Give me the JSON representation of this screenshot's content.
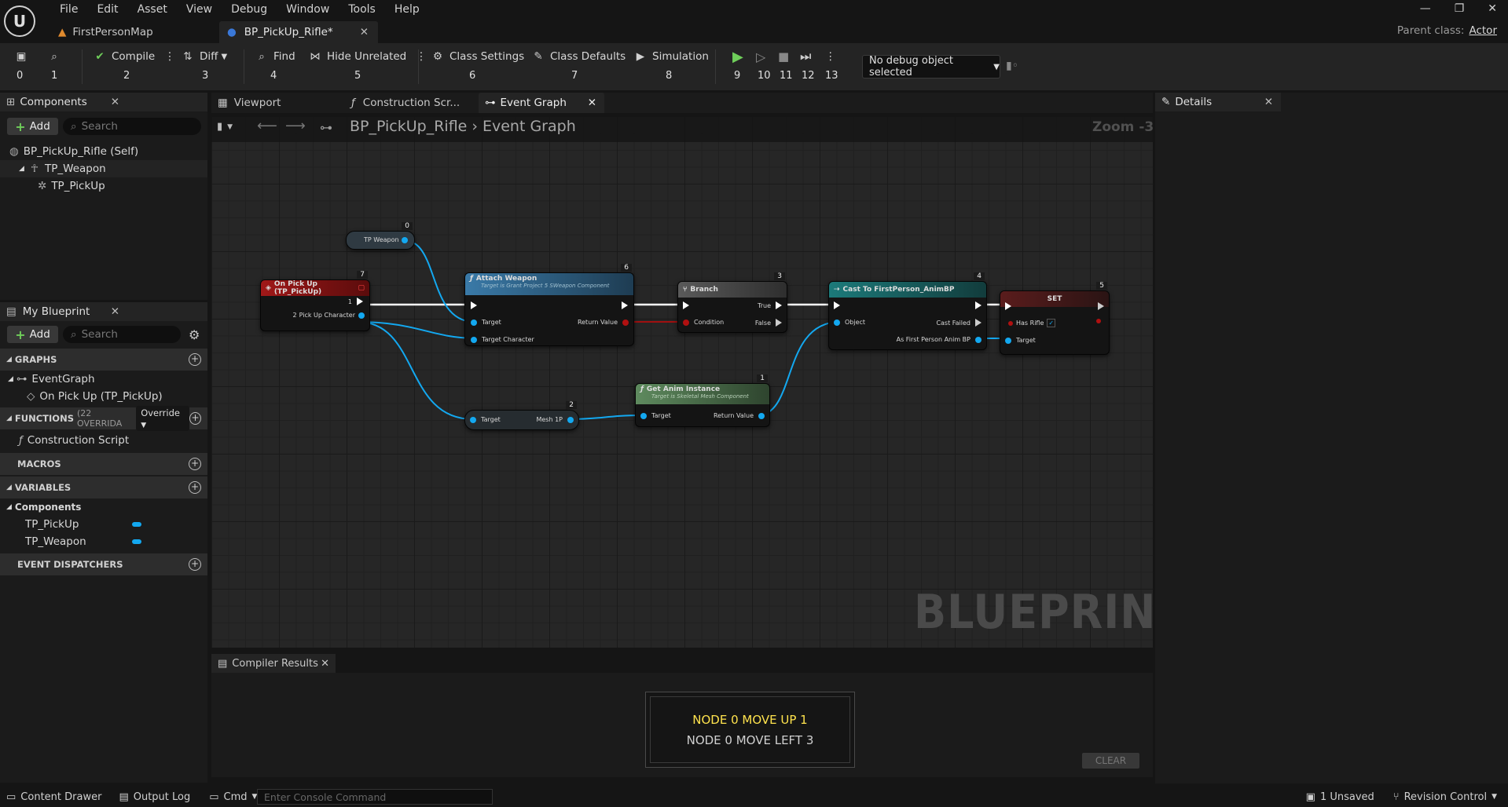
{
  "menu": [
    "File",
    "Edit",
    "Asset",
    "View",
    "Debug",
    "Window",
    "Tools",
    "Help"
  ],
  "doc_tabs": [
    "FirstPersonMap",
    "BP_PickUp_Rifle*"
  ],
  "parent_class": {
    "label": "Parent class:",
    "value": "Actor"
  },
  "toolbar": {
    "compile": "Compile",
    "diff": "Diff",
    "find": "Find",
    "hide_unrelated": "Hide Unrelated",
    "class_settings": "Class Settings",
    "class_defaults": "Class Defaults",
    "simulation": "Simulation",
    "nums": [
      "0",
      "1",
      "2",
      "3",
      "4",
      "5",
      "6",
      "7",
      "8",
      "9",
      "10",
      "11",
      "12",
      "13"
    ]
  },
  "debug_select": "No debug object selected",
  "components": {
    "tab": "Components",
    "add": "Add",
    "search_placeholder": "Search",
    "items": [
      "BP_PickUp_Rifle (Self)",
      "TP_Weapon",
      "TP_PickUp"
    ]
  },
  "my_blueprint": {
    "tab": "My Blueprint",
    "add": "Add",
    "search_placeholder": "Search",
    "graphs": "GRAPHS",
    "event_graph": "EventGraph",
    "on_pickup": "On Pick Up (TP_PickUp)",
    "functions": "FUNCTIONS",
    "functions_count": "(22 OVERRIDA",
    "override": "Override",
    "construction": "Construction Script",
    "macros": "MACROS",
    "variables": "VARIABLES",
    "components_cat": "Components",
    "var1": "TP_PickUp",
    "var2": "TP_Weapon",
    "dispatchers": "EVENT DISPATCHERS"
  },
  "graph_tabs": [
    "Viewport",
    "Construction Scr...",
    "Event Graph"
  ],
  "breadcrumb": {
    "bp": "BP_PickUp_Rifle",
    "graph": "Event Graph"
  },
  "zoom": "Zoom -3",
  "watermark": "BLUEPRINT",
  "details_tab": "Details",
  "nodes": {
    "tp_weapon": {
      "label": "TP Weapon",
      "num": "0"
    },
    "event": {
      "title": "On Pick Up (TP_PickUp)",
      "num": "7",
      "exec_num": "1",
      "pin": "Pick Up Character",
      "pin_num": "2"
    },
    "attach": {
      "title": "Attach Weapon",
      "sub": "Target is Grant Project 5 SWeapon Component",
      "num": "6",
      "target": "Target",
      "target_char": "Target Character",
      "ret": "Return Value"
    },
    "branch": {
      "title": "Branch",
      "num": "3",
      "cond": "Condition",
      "true": "True",
      "false": "False"
    },
    "cast": {
      "title": "Cast To FirstPerson_AnimBP",
      "num": "4",
      "object": "Object",
      "failed": "Cast Failed",
      "as": "As First Person Anim BP"
    },
    "set": {
      "title": "SET",
      "num": "5",
      "has_rifle": "Has Rifle",
      "target": "Target"
    },
    "mesh": {
      "num": "2",
      "target": "Target",
      "mesh": "Mesh 1P"
    },
    "anim": {
      "title": "Get Anim Instance",
      "sub": "Target is Skeletal Mesh Component",
      "num": "1",
      "target": "Target",
      "ret": "Return Value"
    }
  },
  "compiler": {
    "tab": "Compiler Results",
    "msg1": "NODE 0 MOVE UP 1",
    "msg2": "NODE 0 MOVE LEFT 3",
    "clear": "CLEAR"
  },
  "status": {
    "drawer": "Content Drawer",
    "log": "Output Log",
    "cmd": "Cmd",
    "console_placeholder": "Enter Console Command",
    "unsaved": "1 Unsaved",
    "revision": "Revision Control"
  }
}
